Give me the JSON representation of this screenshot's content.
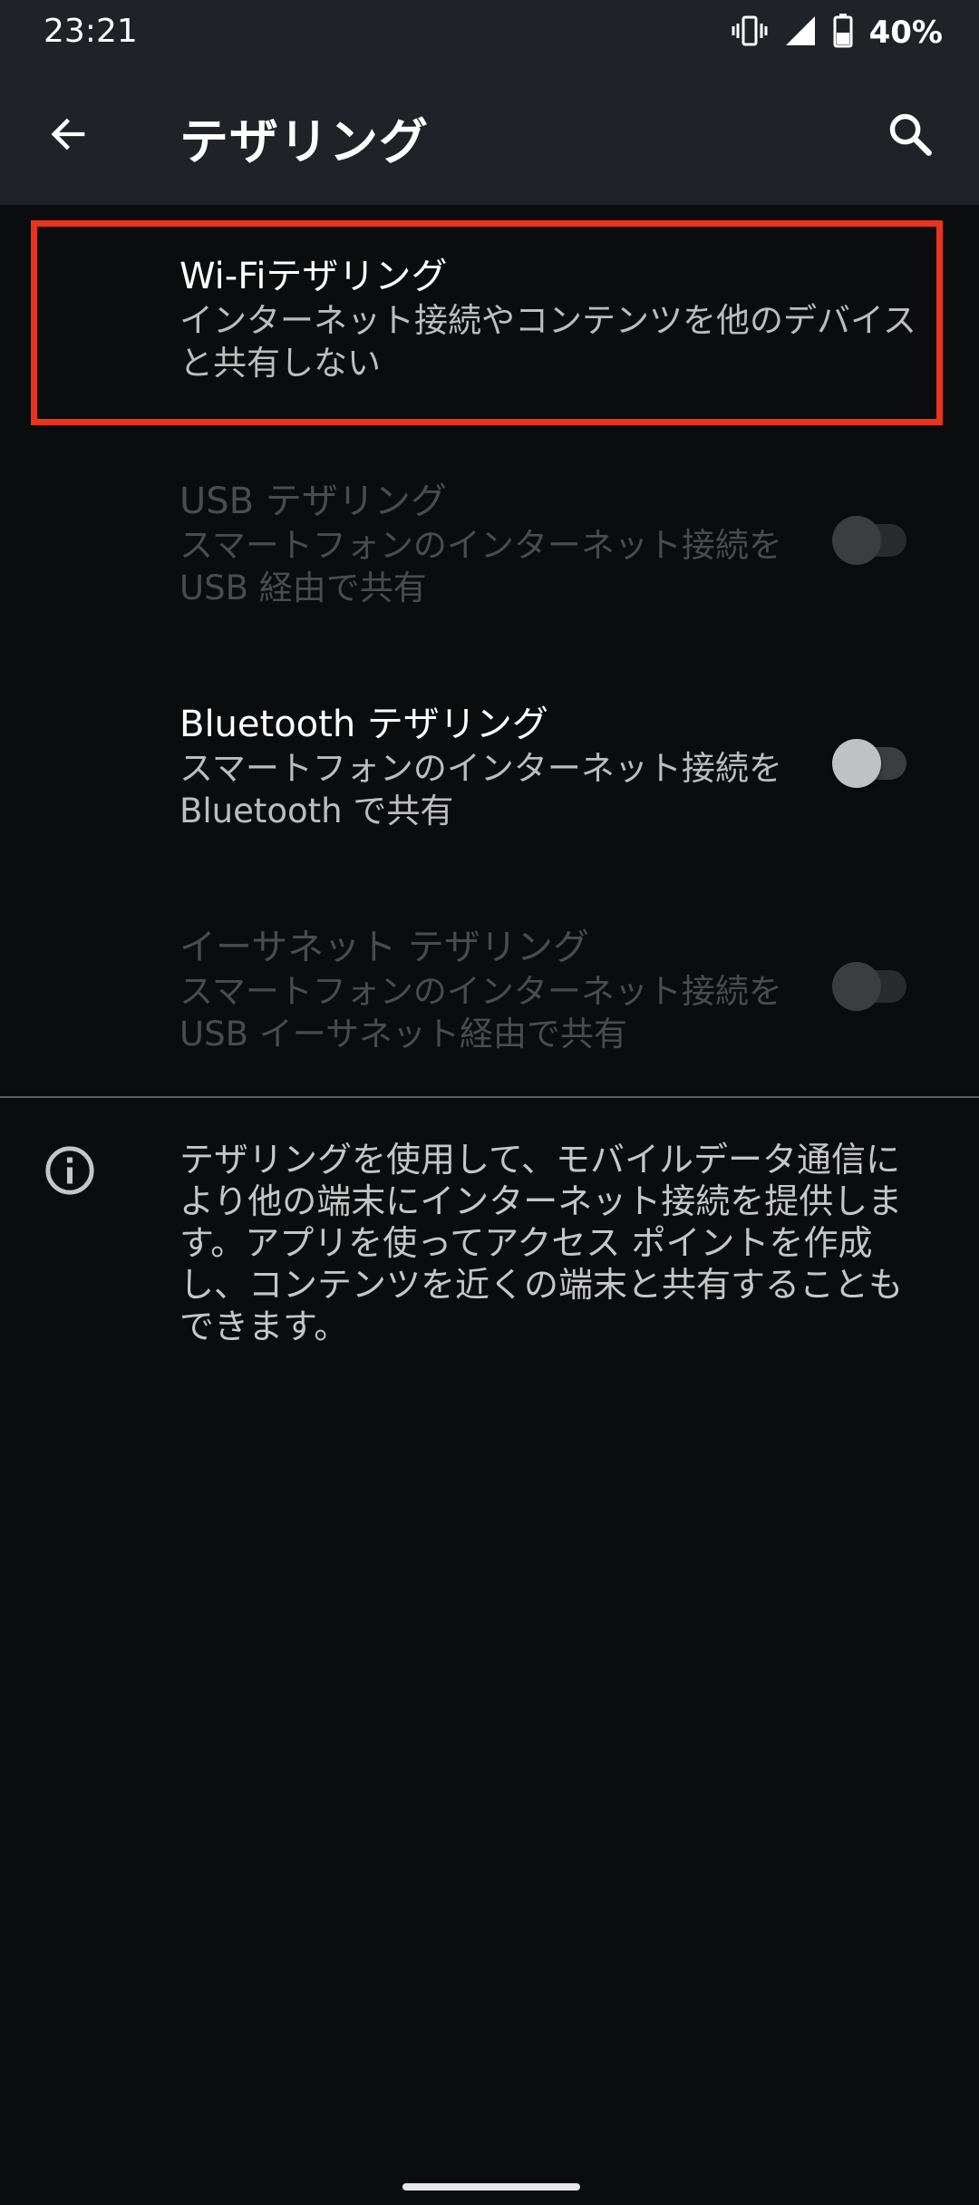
{
  "status_bar": {
    "time": "23:21",
    "battery": "40%",
    "icons": [
      "vibrate-icon",
      "signal-icon",
      "battery-icon"
    ]
  },
  "app_bar": {
    "title": "テザリング",
    "back_icon": "arrow-back-icon",
    "search_icon": "search-icon"
  },
  "items": [
    {
      "title": "Wi-Fiテザリング",
      "summary": "インターネット接続やコンテンツを他のデバイスと共有しない",
      "enabled": true,
      "has_switch": false
    },
    {
      "title": "USB テザリング",
      "summary": "スマートフォンのインターネット接続を USB 経由で共有",
      "enabled": false,
      "has_switch": true,
      "switch_on": false
    },
    {
      "title": "Bluetooth テザリング",
      "summary": "スマートフォンのインターネット接続を Bluetooth で共有",
      "enabled": true,
      "has_switch": true,
      "switch_on": false
    },
    {
      "title": "イーサネット テザリング",
      "summary": "スマートフォンのインターネット接続を USB イーサネット経由で共有",
      "enabled": false,
      "has_switch": true,
      "switch_on": false
    }
  ],
  "footer_info": {
    "icon": "info-icon",
    "text": "テザリングを使用して、モバイルデータ通信により他の端末にインターネット接続を提供します。アプリを使ってアクセス ポイントを作成し、コンテンツを近くの端末と共有することもできます。"
  },
  "colors": {
    "background": "#0b0c0e",
    "app_bar": "#1f2226",
    "highlight": "#e8341c",
    "disabled_text": "#4a4b4d"
  }
}
